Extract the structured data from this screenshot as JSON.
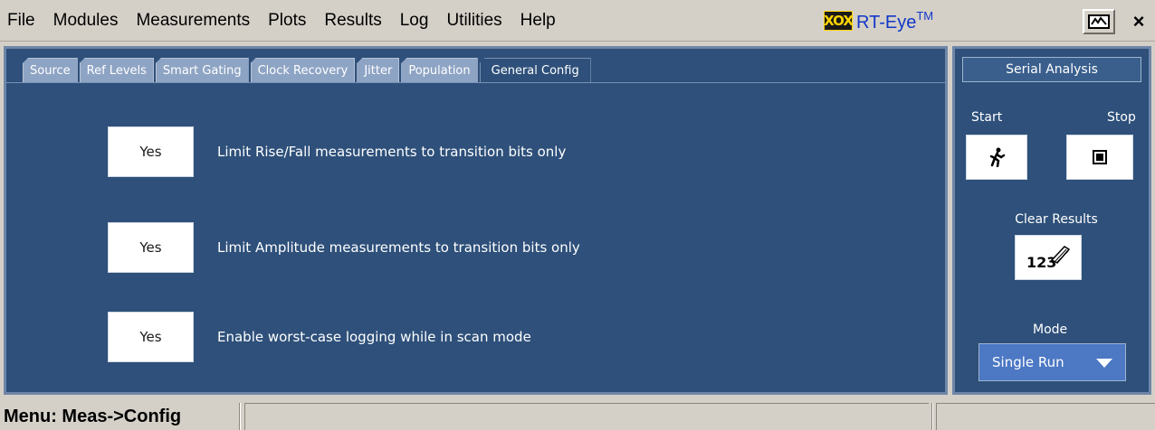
{
  "menubar": {
    "items": [
      "File",
      "Modules",
      "Measurements",
      "Plots",
      "Results",
      "Log",
      "Utilities",
      "Help"
    ],
    "brand_logo": "XOX",
    "brand_name": "RT-Eye",
    "brand_tm": "TM",
    "close_label": "×"
  },
  "tabs": [
    "Source",
    "Ref Levels",
    "Smart Gating",
    "Clock Recovery",
    "Jitter",
    "Population",
    "General Config"
  ],
  "active_tab": "General Config",
  "options": [
    {
      "value": "Yes",
      "label": "Limit Rise/Fall measurements to transition bits only"
    },
    {
      "value": "Yes",
      "label": "Limit Amplitude measurements to transition bits only"
    },
    {
      "value": "Yes",
      "label": "Enable worst-case logging while in scan mode"
    }
  ],
  "side": {
    "title": "Serial Analysis",
    "start_label": "Start",
    "stop_label": "Stop",
    "clear_label": "Clear Results",
    "mode_label": "Mode",
    "mode_value": "Single Run"
  },
  "status": {
    "text": "Menu: Meas->Config"
  },
  "colors": {
    "panel_bg": "#2e507a",
    "tab_inactive": "#8ea4c4",
    "mode_select": "#4c78c4"
  }
}
